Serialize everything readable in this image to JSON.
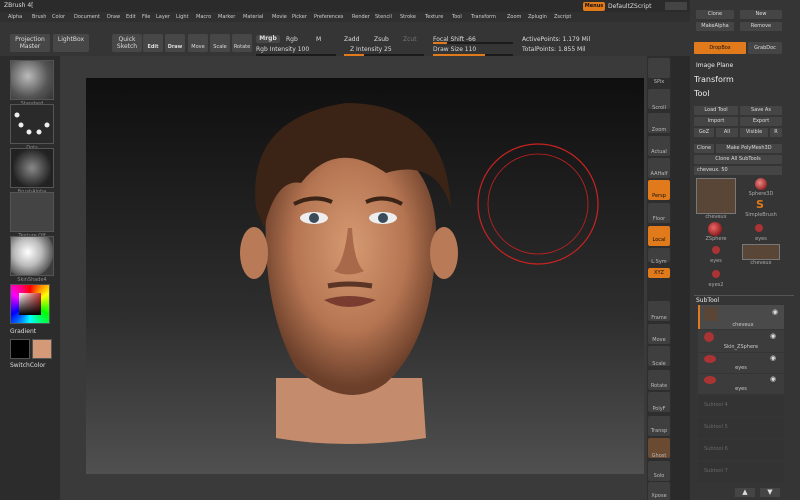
{
  "window": {
    "title": "ZBrush 4["
  },
  "menus": [
    "Alpha",
    "Brush",
    "Color",
    "Document",
    "Draw",
    "Edit",
    "File",
    "Layer",
    "Light",
    "Macro",
    "Marker",
    "Material",
    "Movie",
    "Picker",
    "Preferences",
    "Render",
    "Stencil",
    "Stroke",
    "Texture",
    "Tool",
    "Transform",
    "Zoom",
    "Zplugin",
    "Zscript"
  ],
  "menus_button": "Menus",
  "script_label": "DefaultZScript",
  "shelf": {
    "projection_master": "Projection Master",
    "lightbox": "LightBox",
    "quick_sketch": "Quick Sketch",
    "edit": "Edit",
    "draw": "Draw",
    "move": "Move",
    "scale": "Scale",
    "rotate": "Rotate",
    "mrgb": "Mrgb",
    "rgb": "Rgb",
    "m": "M",
    "rgb_intensity": "Rgb Intensity 100",
    "zadd": "Zadd",
    "zsub": "Zsub",
    "zcut": "Zcut",
    "z_intensity": "Z Intensity 25",
    "focal_shift": "Focal Shift -66",
    "draw_size": "Draw Size 110",
    "active_points": "ActivePoints: 1.179 Mil",
    "total_points": "TotalPoints: 1.855 Mil"
  },
  "left_tray": {
    "items": [
      "Standard",
      "Dots",
      "BrushAlpha",
      "Texture Off",
      "SkinShade4"
    ],
    "gradient": "Gradient",
    "switch_color": "SwitchColor"
  },
  "right_strip": [
    "SPix",
    "Scroll",
    "Zoom",
    "Actual",
    "AAHalf",
    "Persp",
    "Floor",
    "Local",
    "L.Sym",
    "XYZ",
    "Frame",
    "Move",
    "Scale",
    "Rotate",
    "PolyF",
    "Transp",
    "Ghost",
    "Solo",
    "Xpose"
  ],
  "right_panel": {
    "clone": "Clone",
    "new": "New",
    "make_alpha": "MakeAlpha",
    "remove": "Remove",
    "dropbox": "DropBox",
    "grabdoc": "GrabDoc",
    "image_plane": "Image Plane",
    "transform": "Transform",
    "tool": "Tool",
    "load_tool": "Load Tool",
    "save_as": "Save As",
    "import": "Import",
    "export": "Export",
    "goz": "GoZ",
    "all": "All",
    "visible": "Visible",
    "r": "R",
    "clone2": "Clone",
    "make_polymesh": "Make PolyMesh3D",
    "clone_all": "Clone All SubTools",
    "current_tool": "cheveux. 50",
    "tools": [
      "cheveux",
      "Sphere3D",
      "SimpleBrush",
      "ZSphere",
      "eyes",
      "eyes",
      "cheveux",
      "eyes2"
    ],
    "subtool_title": "SubTool",
    "subtools": [
      "cheveux",
      "Skin_ZSphere",
      "eyes",
      "eyes",
      "Subtool 4",
      "Subtool 5",
      "Subtool 6",
      "Subtool 7"
    ]
  },
  "colors": {
    "accent": "#e07a1a",
    "panel": "#353535",
    "canvas_top": "#0f0f0f"
  }
}
